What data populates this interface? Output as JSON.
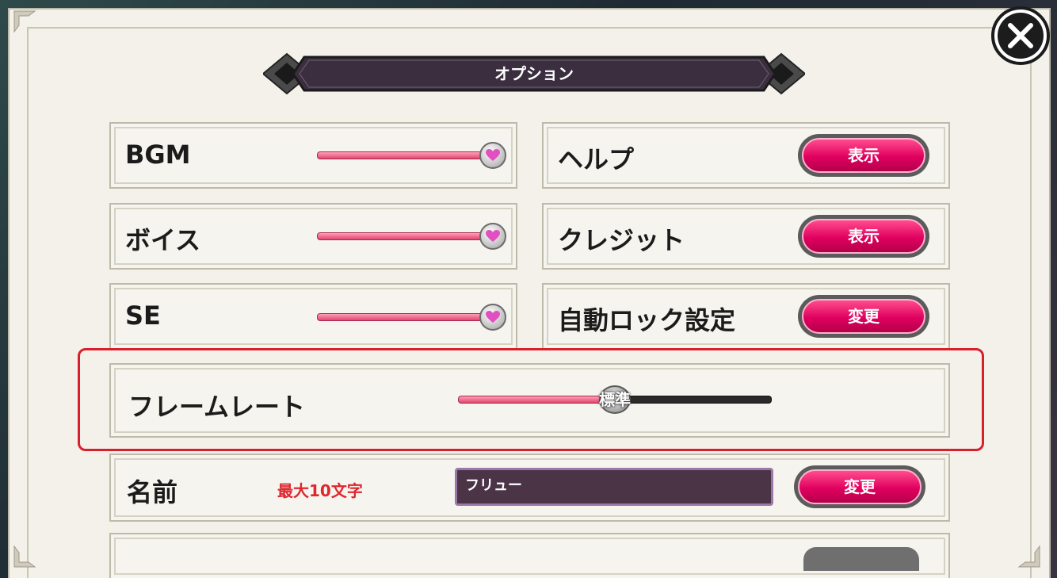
{
  "dialog": {
    "title": "オプション"
  },
  "close_button": {
    "icon": "close-icon"
  },
  "volume": [
    {
      "label": "BGM",
      "level": 1.0
    },
    {
      "label": "ボイス",
      "level": 1.0
    },
    {
      "label": "SE",
      "level": 1.0
    }
  ],
  "actions": [
    {
      "label": "ヘルプ",
      "button": "表示"
    },
    {
      "label": "クレジット",
      "button": "表示"
    },
    {
      "label": "自動ロック設定",
      "button": "変更"
    }
  ],
  "framerate": {
    "label": "フレームレート",
    "value": "標準",
    "level": 0.5
  },
  "name": {
    "label": "名前",
    "limit": "最大10文字",
    "value": "フリュー",
    "button": "変更"
  },
  "colors": {
    "accent_pink": "#e0005f",
    "highlight_red": "#d8202d",
    "title_bar": "#3b2f3f",
    "panel_bg": "#f5f4ee"
  }
}
